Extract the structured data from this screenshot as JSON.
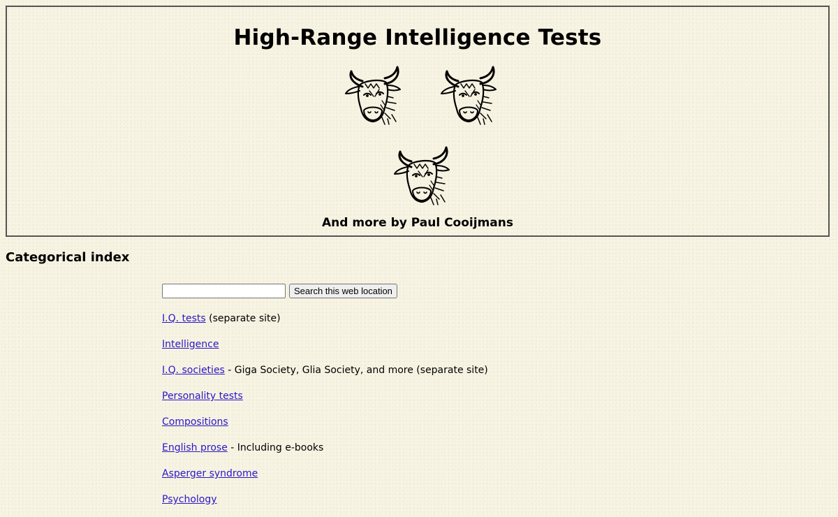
{
  "header": {
    "title": "High-Range Intelligence Tests",
    "byline": "And more by Paul Cooijmans"
  },
  "index": {
    "heading": "Categorical index"
  },
  "search": {
    "value": "",
    "placeholder": "",
    "button_label": "Search this web location"
  },
  "links": [
    {
      "label": "I.Q. tests",
      "suffix": " (separate site)"
    },
    {
      "label": "Intelligence",
      "suffix": ""
    },
    {
      "label": "I.Q. societies",
      "suffix": " - Giga Society, Glia Society, and more (separate site)"
    },
    {
      "label": "Personality tests",
      "suffix": ""
    },
    {
      "label": "Compositions",
      "suffix": ""
    },
    {
      "label": "English prose",
      "suffix": " - Including e-books"
    },
    {
      "label": "Asperger syndrome",
      "suffix": ""
    },
    {
      "label": "Psychology",
      "suffix": ""
    }
  ],
  "icons": {
    "header_images": [
      "bull-head-icon",
      "bull-head-icon",
      "bull-head-icon"
    ]
  },
  "colors": {
    "background": "#f8f4e3",
    "link": "#2a16c8",
    "border": "#555555"
  }
}
